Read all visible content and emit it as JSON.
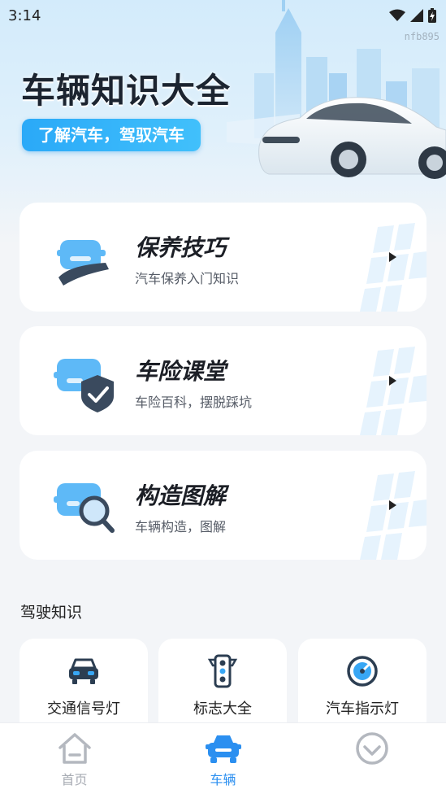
{
  "status_bar": {
    "time": "3:14"
  },
  "watermark": "nfb895",
  "hero": {
    "title": "车辆知识大全",
    "subtitle": "了解汽车，驾驭汽车"
  },
  "cards": [
    {
      "title": "保养技巧",
      "subtitle": "汽车保养入门知识",
      "icon": "car-maintenance-icon"
    },
    {
      "title": "车险课堂",
      "subtitle": "车险百科，摆脱踩坑",
      "icon": "car-insurance-icon"
    },
    {
      "title": "构造图解",
      "subtitle": "车辆构造，图解",
      "icon": "car-structure-icon"
    }
  ],
  "driving_section": {
    "title": "驾驶知识",
    "items": [
      {
        "label": "交通信号灯",
        "icon": "car-front-icon"
      },
      {
        "label": "标志大全",
        "icon": "traffic-light-icon"
      },
      {
        "label": "汽车指示灯",
        "icon": "speedometer-icon"
      }
    ]
  },
  "bottom_nav": {
    "items": [
      {
        "label": "首页",
        "icon": "home-icon",
        "active": false
      },
      {
        "label": "车辆",
        "icon": "car-icon",
        "active": true
      },
      {
        "label": "",
        "icon": "down-circle-icon",
        "active": false
      }
    ]
  },
  "colors": {
    "accent": "#2b8ff0",
    "hero_badge": "#2aa9f8",
    "inactive_nav": "#a7abb3"
  }
}
